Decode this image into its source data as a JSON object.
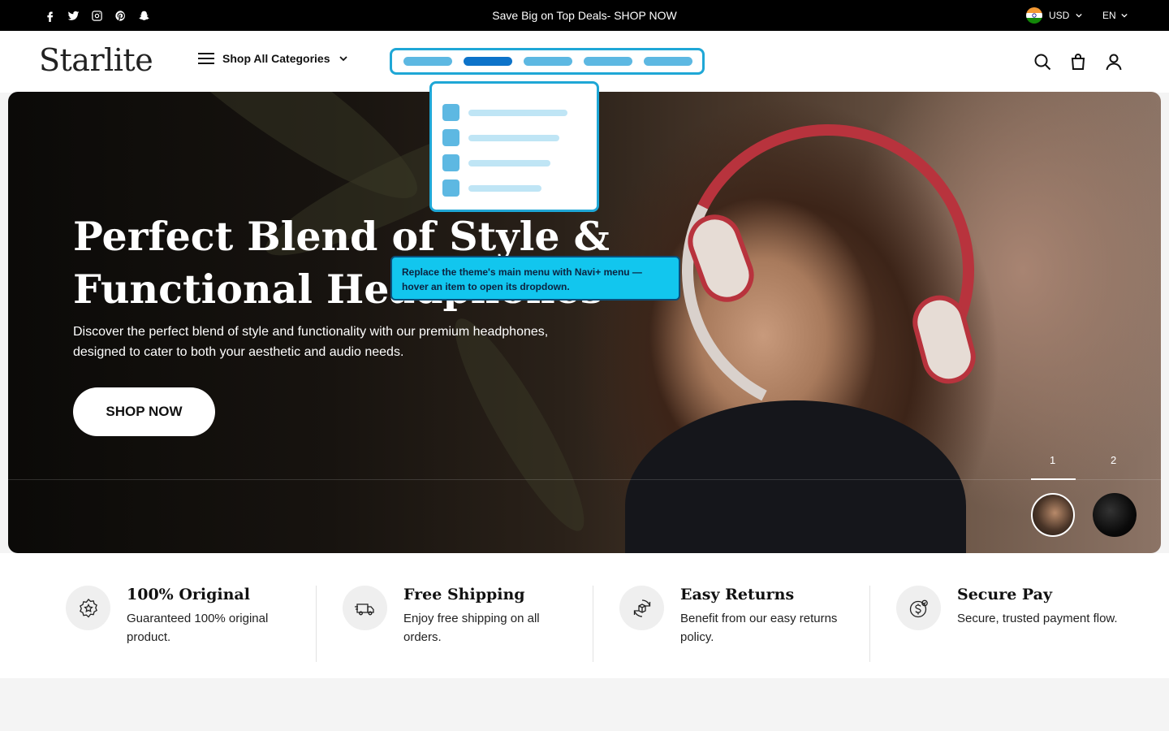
{
  "announcement": {
    "text": "Save Big on Top Deals- SHOP NOW"
  },
  "social_icons": [
    "facebook-icon",
    "twitter-icon",
    "instagram-icon",
    "pinterest-icon",
    "snapchat-icon"
  ],
  "currency": {
    "code": "USD",
    "flag": "india-flag-icon"
  },
  "language": {
    "code": "EN"
  },
  "header": {
    "logo": "Starlite",
    "categories_label": "Shop All Categories",
    "icons": [
      "search-icon",
      "cart-icon",
      "account-icon"
    ]
  },
  "navi_plus": {
    "tooltip": "Replace the theme's main menu with Navi+ menu — hover an item to open its dropdown.",
    "menu_items_count": 5,
    "active_item_index": 1,
    "accent": "#1fa7d6"
  },
  "hero": {
    "title_line1": "Perfect Blend of Style &",
    "title_line2": "Functional Headphones",
    "description": "Discover the perfect blend of style and functionality with our premium headphones, designed to cater to both your aesthetic and audio needs.",
    "button": "SHOP NOW",
    "slides": [
      "1",
      "2"
    ],
    "active_slide": "1"
  },
  "features": [
    {
      "title": "100% Original",
      "desc": "Guaranteed 100% original product.",
      "icon": "badge-star-icon"
    },
    {
      "title": "Free Shipping",
      "desc": "Enjoy free shipping on all orders.",
      "icon": "truck-icon"
    },
    {
      "title": "Easy Returns",
      "desc": "Benefit from our easy returns policy.",
      "icon": "return-box-icon"
    },
    {
      "title": "Secure Pay",
      "desc": "Secure, trusted payment flow.",
      "icon": "secure-coin-icon"
    }
  ]
}
